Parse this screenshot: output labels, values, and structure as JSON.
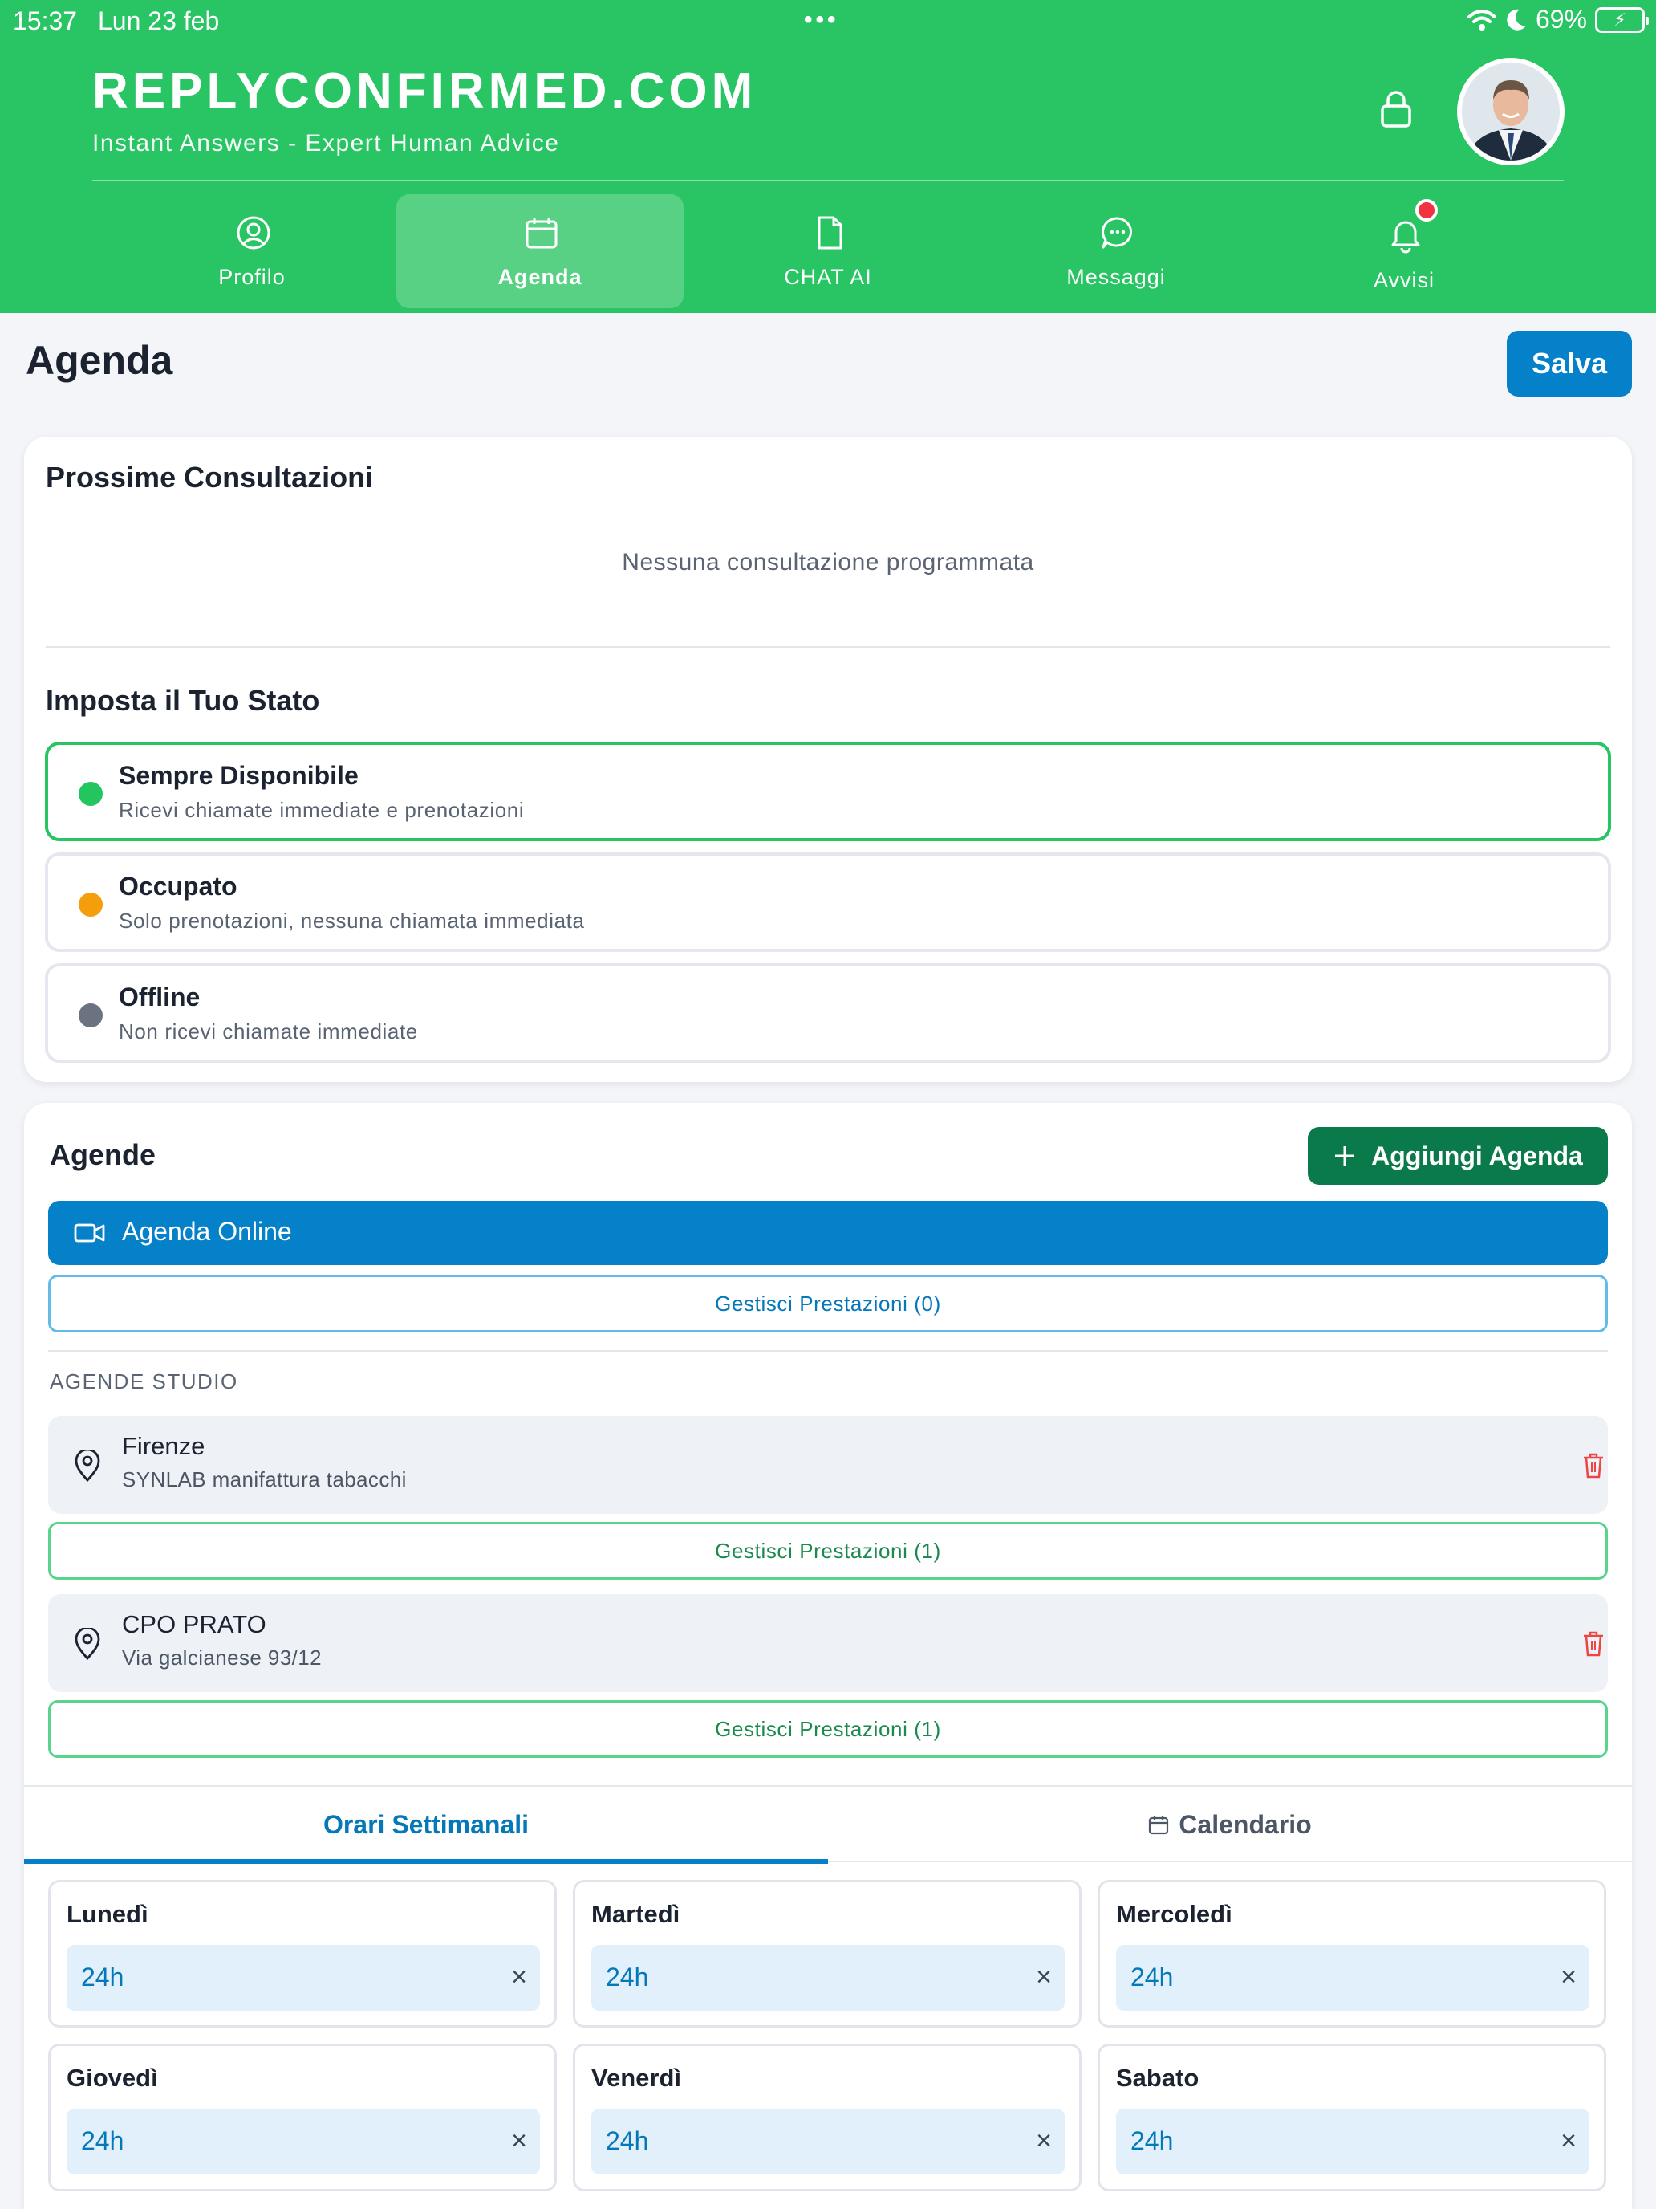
{
  "status_bar": {
    "time": "15:37",
    "date": "Lun 23 feb",
    "battery": "69%"
  },
  "header": {
    "brand": "REPLYCONFIRMED.COM",
    "tagline": "Instant Answers - Expert Human Advice"
  },
  "nav": {
    "tabs": [
      {
        "label": "Profilo",
        "icon": "user-circle-icon",
        "active": false
      },
      {
        "label": "Agenda",
        "icon": "calendar-icon",
        "active": true
      },
      {
        "label": "CHAT AI",
        "icon": "document-icon",
        "active": false
      },
      {
        "label": "Messaggi",
        "icon": "chat-bubble-icon",
        "active": false
      },
      {
        "label": "Avvisi",
        "icon": "bell-icon",
        "active": false,
        "has_notification": true
      }
    ]
  },
  "page": {
    "title": "Agenda",
    "save_label": "Salva"
  },
  "consultations": {
    "title": "Prossime Consultazioni",
    "empty_message": "Nessuna consultazione programmata"
  },
  "status": {
    "title": "Imposta il Tuo Stato",
    "options": [
      {
        "title": "Sempre Disponibile",
        "desc": "Ricevi chiamate immediate e prenotazioni",
        "color": "#22c55e",
        "selected": true
      },
      {
        "title": "Occupato",
        "desc": "Solo prenotazioni, nessuna chiamata immediata",
        "color": "#f59e0b",
        "selected": false
      },
      {
        "title": "Offline",
        "desc": "Non ricevi chiamate immediate",
        "color": "#6b7280",
        "selected": false
      }
    ]
  },
  "agende": {
    "title": "Agende",
    "add_label": "Aggiungi Agenda",
    "online": {
      "label": "Agenda Online",
      "manage_label": "Gestisci Prestazioni (0)"
    },
    "studio_label": "AGENDE STUDIO",
    "studios": [
      {
        "name": "Firenze",
        "address": "SYNLAB manifattura tabacchi",
        "manage_label": "Gestisci Prestazioni (1)"
      },
      {
        "name": "CPO PRATO",
        "address": "Via galcianese 93/12",
        "manage_label": "Gestisci Prestazioni (1)"
      }
    ]
  },
  "schedule": {
    "tabs": [
      {
        "label": "Orari Settimanali",
        "active": true
      },
      {
        "label": "Calendario",
        "active": false
      }
    ],
    "days": [
      {
        "name": "Lunedì",
        "slot": "24h"
      },
      {
        "name": "Martedì",
        "slot": "24h"
      },
      {
        "name": "Mercoledì",
        "slot": "24h"
      },
      {
        "name": "Giovedì",
        "slot": "24h"
      },
      {
        "name": "Venerdì",
        "slot": "24h"
      },
      {
        "name": "Sabato",
        "slot": "24h"
      }
    ]
  },
  "colors": {
    "header_green": "#29c463",
    "primary_blue": "#0481c9",
    "add_button_green": "#0a7a4a",
    "notification_red": "#ef3340"
  }
}
